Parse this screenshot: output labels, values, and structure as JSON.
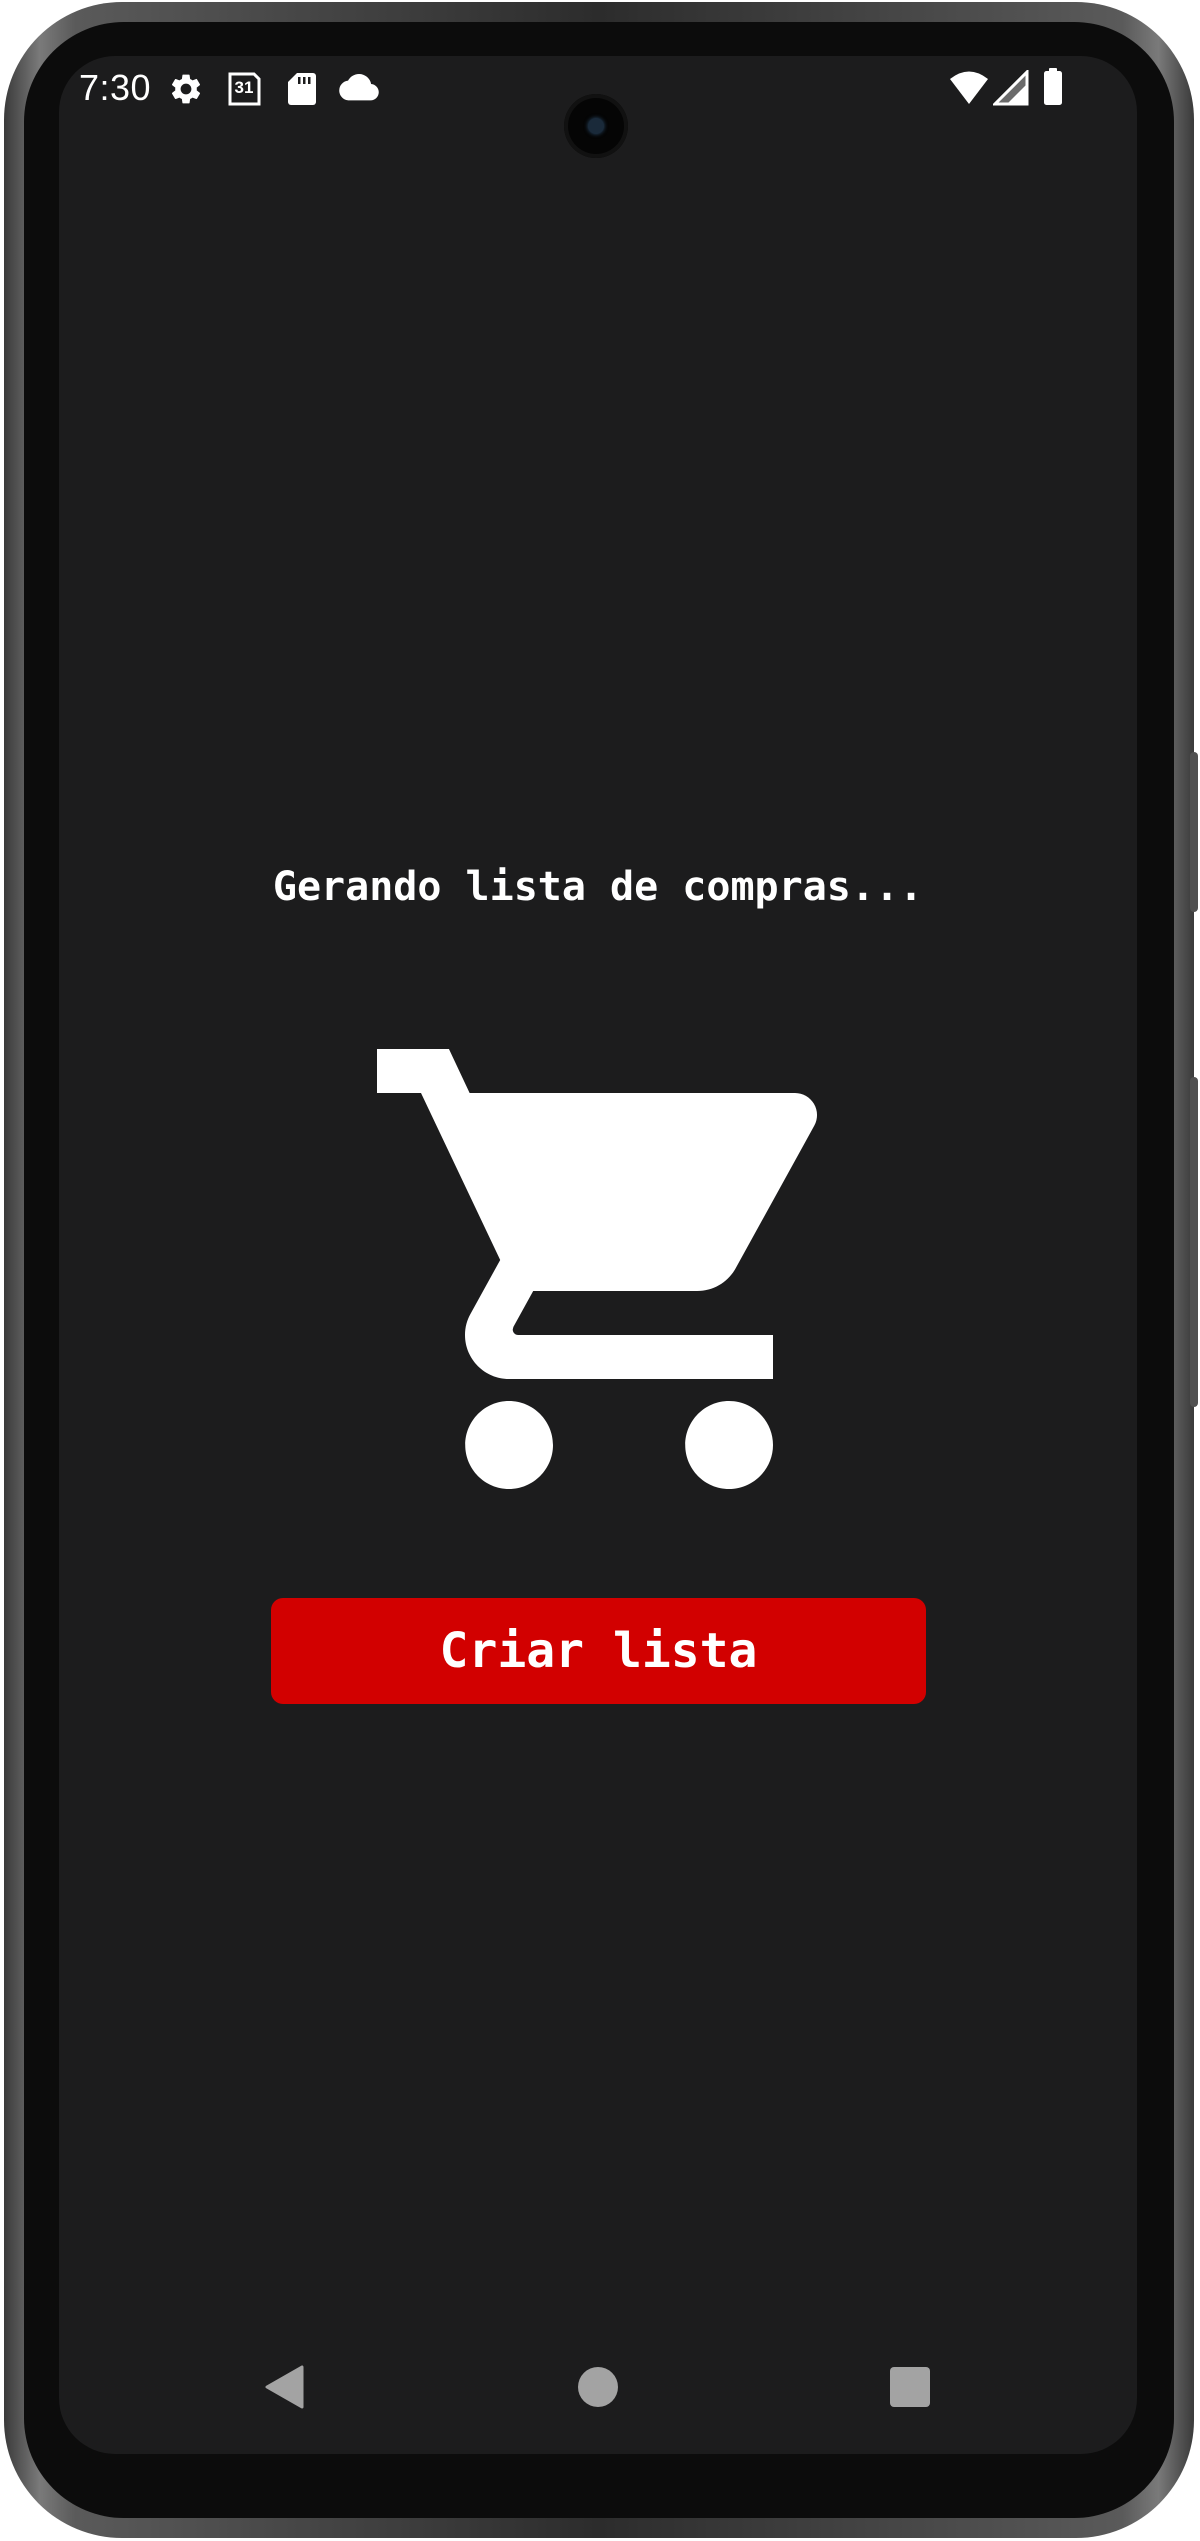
{
  "status_bar": {
    "time": "7:30",
    "calendar_day": "31",
    "left_icons": [
      "gear-icon",
      "calendar-icon",
      "sd-card-icon",
      "cloud-icon"
    ],
    "right_icons": [
      "wifi-icon",
      "cellular-signal-icon",
      "battery-icon"
    ]
  },
  "main": {
    "loading_text": "Gerando lista de compras...",
    "illustration_icon": "shopping-cart-icon",
    "create_button_label": "Criar lista"
  },
  "navigation_bar": {
    "buttons": [
      "back-button",
      "home-button",
      "recents-button"
    ]
  },
  "colors": {
    "background": "#1c1c1d",
    "accent": "#d20000",
    "text": "#ffffff",
    "nav_icons": "#a3a3a3"
  }
}
